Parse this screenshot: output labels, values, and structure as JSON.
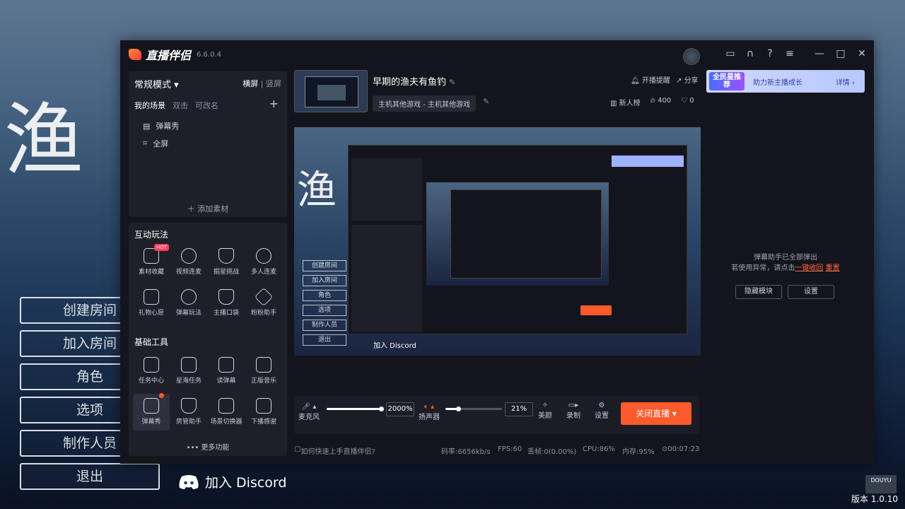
{
  "background": {
    "title": "渔",
    "buttons": [
      "创建房间",
      "加入房间",
      "角色",
      "选项",
      "制作人员",
      "退出"
    ],
    "discord": "加入 Discord",
    "version": "版本 1.0.10",
    "watermark": "DOUYU"
  },
  "app": {
    "name": "直播伴侣",
    "version": "6.6.0.4",
    "mode": "常规模式",
    "orientation": {
      "landscape": "横屏",
      "portrait": "竖屏"
    },
    "scene_tabs": {
      "mine": "我的场景",
      "dual": "双击",
      "rename": "可改名"
    },
    "scenes": [
      "弹幕秀",
      "全屏"
    ],
    "add_material": "添加素材",
    "interactive_title": "互动玩法",
    "interactive_tools": [
      "素材收藏",
      "视频连麦",
      "掘星挑战",
      "多人连麦",
      "礼物心愿",
      "弹幕玩法",
      "主播口袋",
      "粉粉助手"
    ],
    "hot": "HOT",
    "basic_title": "基础工具",
    "basic_tools": [
      "任务中心",
      "星海任务",
      "读弹幕",
      "正版音乐",
      "弹幕秀",
      "房管助手",
      "场景切换器",
      "下播感谢"
    ],
    "more": "更多功能",
    "stream_title": "早期的渔夫有鱼钓",
    "category": "主机其他游戏 - 主机其他游戏",
    "remind": "开播提醒",
    "share": "分享",
    "rank": "新人榜",
    "heat": "400",
    "likes": "0",
    "banner": {
      "badge": "全民星推荐",
      "text": "助力新主播成长",
      "detail": "详情"
    },
    "danmu_info_1": "弹幕助手已全部弹出",
    "danmu_info_2": "若使用异常，请点击",
    "recall": "一键收回",
    "reset": "重置",
    "hide_module": "隐藏模块",
    "settings": "设置",
    "mic_label": "麦克风",
    "mic_pct": "2000%",
    "speaker_label": "扬声器",
    "speaker_pct": "21%",
    "beauty": "美颜",
    "record": "录制",
    "setting_btn": "设置",
    "close_live": "关闭直播",
    "help": "如何快速上手直播伴侣?",
    "bitrate": "码率:6656kb/s",
    "fps": "FPS:60",
    "drop": "丢帧:0(0.00%)",
    "cpu": "CPU:86%",
    "mem": "内存:95%",
    "time": "00:07:23"
  },
  "colors": {
    "accent": "#ff5a2c",
    "window": "#14151c",
    "panel": "#1e1f29"
  }
}
